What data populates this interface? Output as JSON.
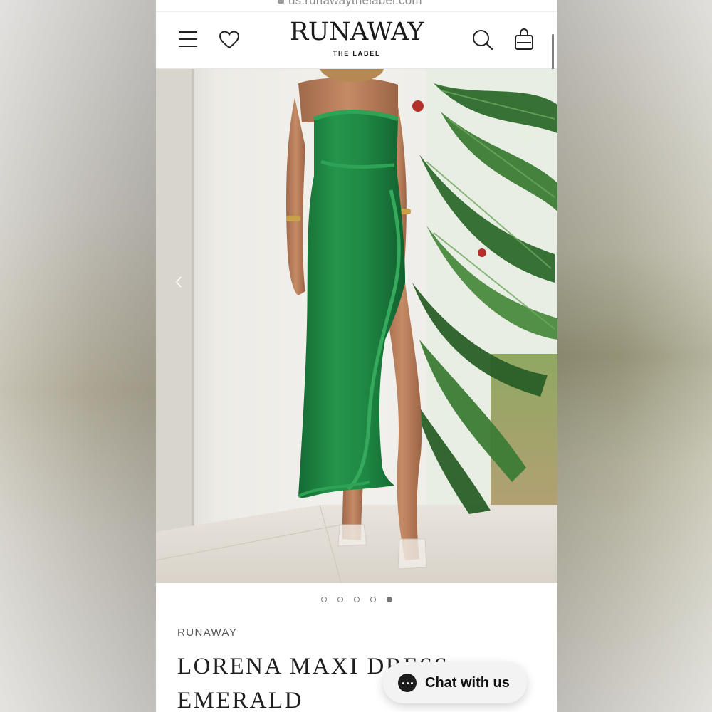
{
  "browser": {
    "url": "us.runawaythelabel.com"
  },
  "header": {
    "logo_text": "RUNAWAY",
    "logo_subtitle": "THE LABEL",
    "menu_icon": "hamburger-icon",
    "wishlist_icon": "heart-icon",
    "search_icon": "search-icon",
    "cart_icon": "shopping-bag-icon"
  },
  "gallery": {
    "image_count": 5,
    "active_index": 5,
    "prev_icon": "chevron-left-icon",
    "dress_color": "#1f8a45"
  },
  "product": {
    "brand": "RUNAWAY",
    "title": "LORENA MAXI DRESS EMERALD"
  },
  "chat": {
    "label": "Chat with us",
    "icon": "chat-bubble-icon"
  }
}
